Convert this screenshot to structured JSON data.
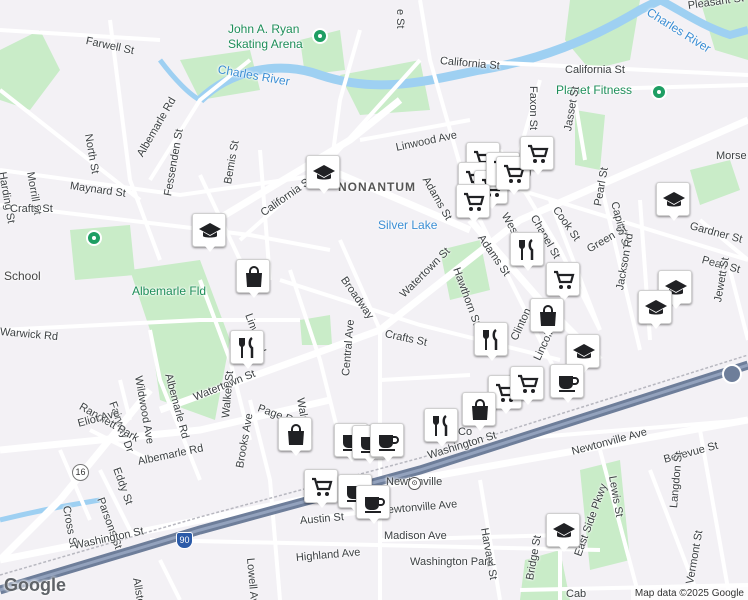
{
  "map": {
    "attribution": "Map data ©2025 Google",
    "logo": "Google",
    "colors": {
      "land": "#f3f1f5",
      "park": "#c9ecc8",
      "water": "#9ed0f2",
      "road": "#ffffff",
      "highway": "#6e7e9a",
      "pin_icon": "#202124"
    }
  },
  "labels": {
    "john_ryan": "John A. Ryan\nSkating Arena",
    "farwell": "Farwell St",
    "charles_river_1": "Charles River",
    "charles_river_2": "Charles River",
    "california_1": "California St",
    "california_2": "California St",
    "california_3": "California St",
    "pleasant": "Pleasant St",
    "planet_fitness": "Planet Fitness",
    "faxon": "Faxon St",
    "jasset": "Jasset St",
    "north": "North St",
    "albemarle_rd_n": "Albemarle Rd",
    "harding": "Harding St",
    "morrill": "Morrill St",
    "maynard": "Maynard St",
    "crafts_w": "Crafts St",
    "fessenden": "Fessenden St",
    "bemis": "Bemis St",
    "linwood": "Linwood Ave",
    "nonantum": "NONANTUM",
    "adams_n": "Adams St",
    "west": "West St",
    "chapel": "Chapel St",
    "cook": "Cook St",
    "pearl_n": "Pearl St",
    "capital": "Capital St",
    "gardner": "Gardner St",
    "morse": "Morse",
    "silver_lake": "Silver Lake",
    "school": "School",
    "albemarle_fld": "Albemarle Fld",
    "broadway": "Broadway",
    "watertown_n": "Watertown St",
    "adams_s": "Adams St",
    "hawthorn": "Hawthorn St",
    "green": "Green St",
    "jackson": "Jackson Rd",
    "pearl_e": "Pearl St",
    "jewett": "Jewett St",
    "warwick": "Warwick Rd",
    "linwood_s": "Linwood",
    "crafts_c": "Crafts St",
    "clinton": "Clinton",
    "lincoln": "Lincoln Rd",
    "central": "Central Ave",
    "wildwood": "Wildwood Ave",
    "albemarle_rd_s": "Albemarle Rd",
    "fairway": "Fairway Dr",
    "randlett": "Randlett Park",
    "eliot": "Eliot Ave",
    "watertown_s": "Watertown St",
    "walker": "Walker St",
    "page": "Page Rd",
    "walnut": "Walnut St",
    "albemarle_rd_sw": "Albemarle Rd",
    "eddy": "Eddy St",
    "brooks": "Brooks Ave",
    "newtonville_ave_e": "Newtonville Ave",
    "bellevue": "Bellevue St",
    "lewis": "Lewis St",
    "washington_e": "Washington St",
    "newtonville": "Newtonville",
    "newtonville_ave_s": "Newtonville Ave",
    "harvard": "Harvard St",
    "langdon": "Langdon St",
    "cross": "Cross St",
    "parsons": "Parsons St",
    "austin": "Austin St",
    "madison": "Madison Ave",
    "lowell": "Lowell Ave",
    "highland": "Highland Ave",
    "washington_park": "Washington Park",
    "washington_w": "Washington St",
    "allston": "Allston St",
    "east_side": "East Side Pkwy",
    "bridge": "Bridge St",
    "vermont": "Vermont St",
    "cab": "Cab",
    "co": "Co",
    "st_n": "e St"
  },
  "shields": {
    "r16a": "16",
    "r16b": "16",
    "i90": "90"
  },
  "pins": [
    {
      "type": "cart",
      "icon": "cart-icon"
    },
    {
      "type": "education",
      "icon": "school-icon"
    },
    {
      "type": "shopping",
      "icon": "shopping-bag-icon"
    },
    {
      "type": "restaurant",
      "icon": "fork-knife-icon"
    },
    {
      "type": "cafe",
      "icon": "coffee-cup-icon"
    }
  ]
}
